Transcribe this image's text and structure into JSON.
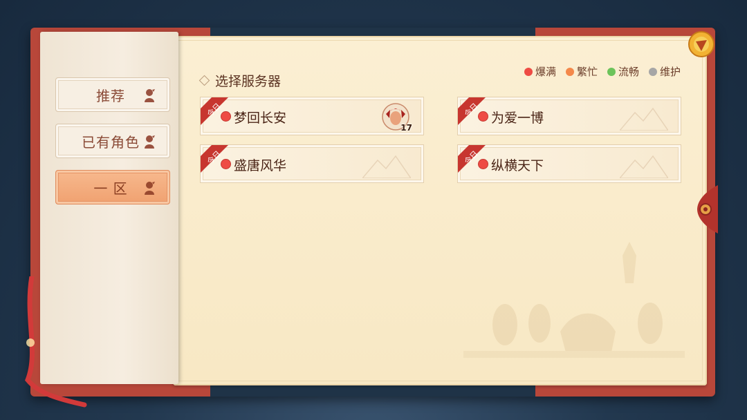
{
  "sidebar": {
    "tabs": [
      {
        "label": "推荐",
        "active": false
      },
      {
        "label": "已有角色",
        "active": false
      },
      {
        "label": "一 区",
        "active": true
      }
    ]
  },
  "main": {
    "section_title": "选择服务器",
    "legend": [
      {
        "label": "爆满",
        "color": "#ee4b44"
      },
      {
        "label": "繁忙",
        "color": "#f4884a"
      },
      {
        "label": "流畅",
        "color": "#6cc35a"
      },
      {
        "label": "维护",
        "color": "#a6a6a6"
      }
    ],
    "servers": [
      {
        "name": "梦回长安",
        "tag": "今日",
        "status": "爆满",
        "has_character": true,
        "character_level": "17"
      },
      {
        "name": "为爱一博",
        "tag": "今日",
        "status": "爆满",
        "has_character": false
      },
      {
        "name": "盛唐风华",
        "tag": "今日",
        "status": "爆满",
        "has_character": false
      },
      {
        "name": "纵横天下",
        "tag": "今日",
        "status": "爆满",
        "has_character": false
      }
    ]
  },
  "colors": {
    "accent_active_tab": "#f0a170",
    "book_cover": "#b8473a",
    "page": "#f8e8c4"
  }
}
